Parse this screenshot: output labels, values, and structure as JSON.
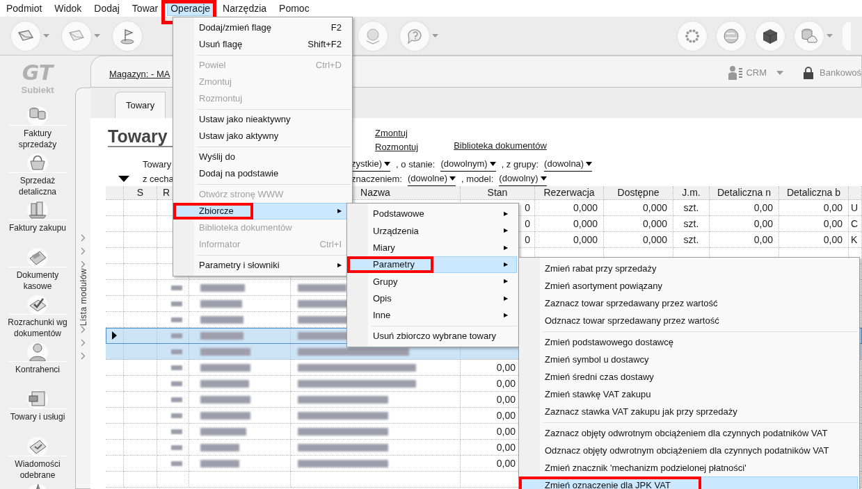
{
  "menubar": [
    {
      "label": "Podmiot",
      "selected": false,
      "annotated": false
    },
    {
      "label": "Widok",
      "selected": false,
      "annotated": false
    },
    {
      "label": "Dodaj",
      "selected": false,
      "annotated": false
    },
    {
      "label": "Towar",
      "selected": false,
      "annotated": false
    },
    {
      "label": "Operacje",
      "selected": true,
      "annotated": true
    },
    {
      "label": "Narzędzia",
      "selected": false,
      "annotated": false
    },
    {
      "label": "Pomoc",
      "selected": false,
      "annotated": false
    }
  ],
  "sidebar": {
    "logo_mark": "GT",
    "logo_name": "Subiekt",
    "module_list_label": "Lista modułów",
    "modules": [
      {
        "kind": "labeled",
        "label": "Faktury sprzedaży"
      },
      {
        "kind": "labeled",
        "label": "Sprzedaż detaliczna"
      },
      {
        "kind": "labeled",
        "label": "Faktury zakupu"
      },
      {
        "kind": "labeled",
        "label": "Dokumenty kasowe"
      },
      {
        "kind": "labeled",
        "label": "Rozrachunki wg dokumentów"
      },
      {
        "kind": "labeled",
        "label": "Kontrahenci"
      },
      {
        "kind": "labeled",
        "label": "Towary i usługi"
      },
      {
        "kind": "labeled",
        "label": "Wiadomości odebrane"
      },
      {
        "kind": "icon_only"
      }
    ]
  },
  "header": {
    "warehouse_link": "Magazyn: - MA",
    "crm": "CRM",
    "banking": "Bankowoś"
  },
  "tabs": [
    {
      "label": "Towary",
      "selected": true
    }
  ],
  "title": "Towary",
  "links": [
    "Zmontuj",
    "Rozmontuj",
    "Biblioteka dokumentów"
  ],
  "filters": [
    {
      "left": "Towary",
      "parts": [
        {
          "kind": "dropdown",
          "text": "zystkie)"
        },
        {
          "kind": "label",
          "text": ", o stanie:"
        },
        {
          "kind": "dropdown",
          "text": "(dowolnym)"
        },
        {
          "kind": "label",
          "text": ", z grupy:"
        },
        {
          "kind": "dropdown",
          "text": "(dowolna)"
        }
      ]
    },
    {
      "left": "z cecha",
      "parts": [
        {
          "kind": "label",
          "text": "znaczeniem:"
        },
        {
          "kind": "dropdown",
          "text": "(dowolne)"
        },
        {
          "kind": "label",
          "text": ", model:"
        },
        {
          "kind": "dropdown",
          "text": "(dowolny)"
        }
      ]
    }
  ],
  "table": {
    "columns": [
      null,
      "S",
      "R",
      null,
      "Nazwa",
      "Stan",
      "Rezerwacja",
      "Dostępne",
      "J.m.",
      "Detaliczna n",
      "Detaliczna b",
      null
    ],
    "rows": [
      {
        "selected": false,
        "current": false,
        "redacted": false,
        "cells": [
          null,
          null,
          null,
          null,
          null,
          "0",
          "0,000",
          "0,000",
          "szt.",
          "0,00",
          "0,00",
          "U"
        ]
      },
      {
        "selected": false,
        "current": false,
        "redacted": false,
        "cells": [
          null,
          null,
          null,
          null,
          null,
          "0",
          "0,000",
          "0,000",
          "szt.",
          "0,00",
          "0,00",
          "C"
        ]
      },
      {
        "selected": false,
        "current": false,
        "redacted": false,
        "cells": [
          null,
          null,
          null,
          null,
          null,
          "0",
          "0,000",
          "0,000",
          "szt.",
          "0,00",
          "0,00",
          "K"
        ]
      },
      {
        "selected": false,
        "current": false,
        "redacted": false,
        "cells": []
      },
      {
        "selected": false,
        "current": false,
        "redacted": false,
        "cells": []
      },
      {
        "selected": false,
        "current": false,
        "redacted": true,
        "cells": []
      },
      {
        "selected": false,
        "current": false,
        "redacted": true,
        "cells": []
      },
      {
        "selected": false,
        "current": false,
        "redacted": true,
        "cells": []
      },
      {
        "selected": true,
        "current": true,
        "redacted": true,
        "cells": []
      },
      {
        "selected": true,
        "current": false,
        "redacted": true,
        "cells": []
      },
      {
        "selected": false,
        "current": false,
        "redacted": true,
        "cells": [
          null,
          null,
          null,
          null,
          null,
          "0,00"
        ]
      },
      {
        "selected": false,
        "current": false,
        "redacted": true,
        "cells": [
          null,
          null,
          null,
          null,
          null,
          "0,00"
        ]
      },
      {
        "selected": false,
        "current": false,
        "redacted": true,
        "cells": [
          null,
          null,
          null,
          null,
          null,
          "0,00"
        ]
      },
      {
        "selected": false,
        "current": false,
        "redacted": true,
        "cells": [
          null,
          null,
          null,
          null,
          null,
          "0,00"
        ]
      },
      {
        "selected": false,
        "current": false,
        "redacted": true,
        "cells": [
          null,
          null,
          null,
          null,
          null,
          "0,00"
        ]
      },
      {
        "selected": false,
        "current": false,
        "redacted": true,
        "cells": [
          null,
          null,
          null,
          null,
          null,
          "0,00"
        ]
      },
      {
        "selected": false,
        "current": false,
        "redacted": true,
        "cells": [
          null,
          null,
          null,
          null,
          null,
          "0,00"
        ]
      }
    ]
  },
  "operations_menu": [
    {
      "kind": "item",
      "label": "Dodaj/zmień flagę",
      "shortcut": "F2",
      "disabled": false,
      "selected": false,
      "annotated": false
    },
    {
      "kind": "item",
      "label": "Usuń flagę",
      "shortcut": "Shift+F2",
      "disabled": false,
      "selected": false,
      "annotated": false
    },
    {
      "kind": "separator"
    },
    {
      "kind": "item",
      "label": "Powiel",
      "shortcut": "Ctrl+D",
      "disabled": true,
      "selected": false,
      "annotated": false
    },
    {
      "kind": "item",
      "label": "Zmontuj",
      "disabled": true,
      "selected": false,
      "annotated": false
    },
    {
      "kind": "item",
      "label": "Rozmontuj",
      "disabled": true,
      "selected": false,
      "annotated": false
    },
    {
      "kind": "separator"
    },
    {
      "kind": "item",
      "label": "Ustaw jako nieaktywny",
      "disabled": false,
      "selected": false,
      "annotated": false
    },
    {
      "kind": "item",
      "label": "Ustaw jako aktywny",
      "disabled": false,
      "selected": false,
      "annotated": false
    },
    {
      "kind": "separator"
    },
    {
      "kind": "item",
      "label": "Wyślij do",
      "disabled": false,
      "selected": false,
      "annotated": false
    },
    {
      "kind": "item",
      "label": "Dodaj na podstawie",
      "disabled": false,
      "selected": false,
      "annotated": false
    },
    {
      "kind": "separator"
    },
    {
      "kind": "item",
      "label": "Otwórz stronę WWW",
      "disabled": true,
      "selected": false,
      "annotated": false
    },
    {
      "kind": "item",
      "label": "Zbiorcze",
      "arrow": "▶",
      "disabled": false,
      "selected": true,
      "annotated": true
    },
    {
      "kind": "item",
      "label": "Biblioteka dokumentów",
      "disabled": true,
      "selected": false,
      "annotated": false
    },
    {
      "kind": "item",
      "label": "Informator",
      "shortcut": "Ctrl+I",
      "disabled": true,
      "selected": false,
      "annotated": false
    },
    {
      "kind": "separator"
    },
    {
      "kind": "item",
      "label": "Parametry i słowniki",
      "arrow": "▶",
      "disabled": false,
      "selected": false,
      "annotated": false
    }
  ],
  "collective_menu": [
    {
      "kind": "item",
      "label": "Podstawowe",
      "arrow": "▶",
      "disabled": false,
      "selected": false,
      "annotated": false
    },
    {
      "kind": "item",
      "label": "Urządzenia",
      "arrow": "▶",
      "disabled": false,
      "selected": false,
      "annotated": false
    },
    {
      "kind": "item",
      "label": "Miary",
      "arrow": "▶",
      "disabled": false,
      "selected": false,
      "annotated": false
    },
    {
      "kind": "item",
      "label": "Parametry",
      "arrow": "▶",
      "disabled": false,
      "selected": true,
      "annotated": true
    },
    {
      "kind": "item",
      "label": "Grupy",
      "arrow": "▶",
      "disabled": false,
      "selected": false,
      "annotated": false
    },
    {
      "kind": "item",
      "label": "Opis",
      "arrow": "▶",
      "disabled": false,
      "selected": false,
      "annotated": false
    },
    {
      "kind": "item",
      "label": "Inne",
      "arrow": "▶",
      "disabled": false,
      "selected": false,
      "annotated": false
    },
    {
      "kind": "separator"
    },
    {
      "kind": "item",
      "label": "Usuń zbiorczo wybrane towary",
      "disabled": false,
      "selected": false,
      "annotated": false
    }
  ],
  "parameters_menu": [
    {
      "kind": "item",
      "label": "Zmień rabat przy sprzedaży",
      "disabled": false,
      "selected": false,
      "annotated": false
    },
    {
      "kind": "item",
      "label": "Zmień asortyment powiązany",
      "disabled": false,
      "selected": false,
      "annotated": false
    },
    {
      "kind": "item",
      "label": "Zaznacz towar sprzedawany przez wartość",
      "disabled": false,
      "selected": false,
      "annotated": false
    },
    {
      "kind": "item",
      "label": "Odznacz towar sprzedawany przez wartość",
      "disabled": false,
      "selected": false,
      "annotated": false
    },
    {
      "kind": "separator"
    },
    {
      "kind": "item",
      "label": "Zmień podstawowego dostawcę",
      "disabled": false,
      "selected": false,
      "annotated": false
    },
    {
      "kind": "item",
      "label": "Zmień symbol u dostawcy",
      "disabled": false,
      "selected": false,
      "annotated": false
    },
    {
      "kind": "item",
      "label": "Zmień średni czas dostawy",
      "disabled": false,
      "selected": false,
      "annotated": false
    },
    {
      "kind": "item",
      "label": "Zmień stawkę VAT zakupu",
      "disabled": false,
      "selected": false,
      "annotated": false
    },
    {
      "kind": "item",
      "label": "Zaznacz stawka VAT zakupu jak przy sprzedaży",
      "disabled": false,
      "selected": false,
      "annotated": false
    },
    {
      "kind": "separator"
    },
    {
      "kind": "item",
      "label": "Zaznacz objęty odwrotnym obciążeniem dla czynnych podatników VAT",
      "disabled": false,
      "selected": false,
      "annotated": false
    },
    {
      "kind": "item",
      "label": "Odznacz objęty odwrotnym obciążeniem dla czynnych podatników VAT",
      "disabled": false,
      "selected": false,
      "annotated": false
    },
    {
      "kind": "item",
      "label": "Zmień znacznik 'mechanizm podzielonej płatności'",
      "disabled": false,
      "selected": false,
      "annotated": false
    },
    {
      "kind": "item",
      "label": "Zmień oznaczenie dla JPK VAT",
      "disabled": false,
      "selected": true,
      "annotated": true
    }
  ]
}
